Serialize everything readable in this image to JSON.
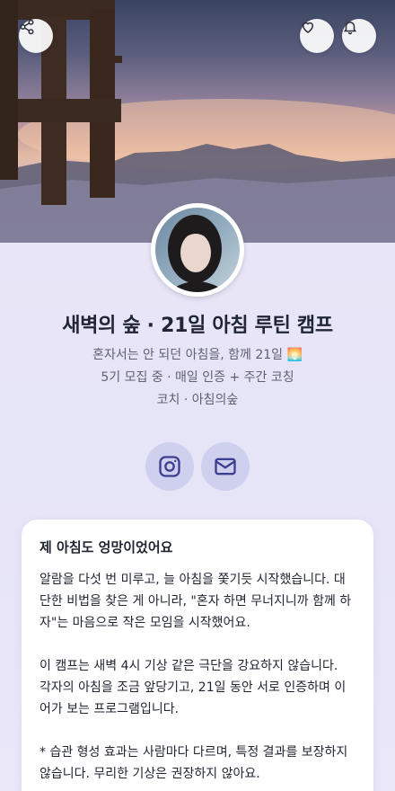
{
  "header": {
    "share_icon": "share-icon",
    "like_icon": "heart-icon",
    "notify_icon": "bell-icon"
  },
  "profile": {
    "title": "새벽의 숲 · 21일 아침 루틴 캠프",
    "tagline": "혼자서는 안 되던 아침을, 함께 21일",
    "tagline_emoji": "🌅",
    "recruit_info": "5기 모집 중 · 매일 인증 + 주간 코칭",
    "coach_label": "코치 · 아침의숲"
  },
  "social": {
    "instagram_icon": "instagram-icon",
    "mail_icon": "mail-icon"
  },
  "card": {
    "heading": "제 아침도 엉망이었어요",
    "p1": "알람을 다섯 번 미루고, 늘 아침을 쫓기듯 시작했습니다. 대단한 비법을 찾은 게 아니라, \"혼자 하면 무너지니까 함께 하자\"는 마음으로 작은 모임을 시작했어요.",
    "p2": "이 캠프는 새벽 4시 기상 같은 극단을 강요하지 않습니다.",
    "p3": "각자의 아침을 조금 앞당기고, 21일 동안 서로 인증하며 이어가 보는 프로그램입니다.",
    "p4": "* 습관 형성 효과는 사람마다 다르며, 특정 결과를 보장하지 않습니다. 무리한 기상은 권장하지 않아요."
  },
  "colors": {
    "accent_circle": "#cfd0ee",
    "icon_stroke": "#3c3f8f",
    "title": "#1f2536"
  }
}
